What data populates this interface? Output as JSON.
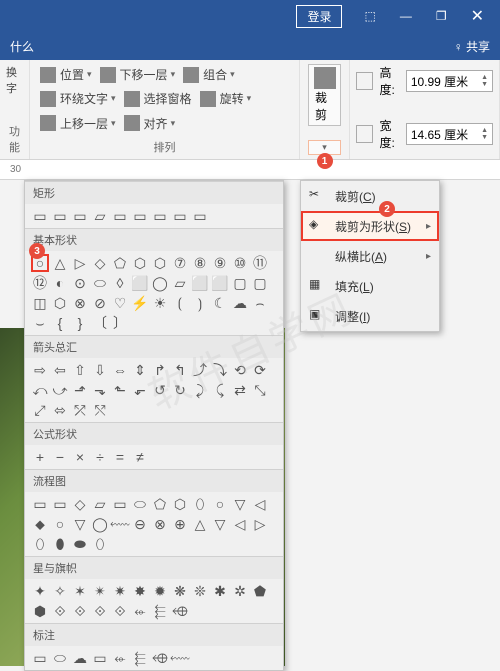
{
  "title_bar": {
    "login": "登录",
    "restore_full": "⬚",
    "minimize": "—",
    "restore": "❐",
    "close": "✕"
  },
  "tab_row": {
    "tell_me": "什么",
    "share": "共享"
  },
  "ribbon": {
    "position": "位置",
    "wrap": "环绕文字",
    "send_forward": "上移一层",
    "send_backward": "下移一层",
    "selection_pane": "选择窗格",
    "align": "对齐",
    "group": "组合",
    "rotate": "旋转",
    "arrange_label": "排列",
    "crop": "裁剪",
    "height_label": "高度:",
    "width_label": "宽度:",
    "height_val": "10.99 厘米",
    "width_val": "14.65 厘米",
    "alt_group": "换字",
    "alt_label": "功能"
  },
  "ruler_val": "30",
  "crop_menu": {
    "crop": "裁剪(C)",
    "crop_to_shape": "裁剪为形状(S)",
    "aspect_ratio": "纵横比(A)",
    "fill": "填充(L)",
    "fit": "调整(I)"
  },
  "shape_categories": {
    "rectangles": "矩形",
    "basic": "基本形状",
    "arrows": "箭头总汇",
    "equation": "公式形状",
    "flowchart": "流程图",
    "stars": "星与旗帜",
    "callouts": "标注"
  },
  "shapes": {
    "rectangles": [
      "▭",
      "▭",
      "▭",
      "▱",
      "▭",
      "▭",
      "▭",
      "▭",
      "▭"
    ],
    "basic": [
      "○",
      "△",
      "▷",
      "◇",
      "⬠",
      "⬡",
      "⬡",
      "⑦",
      "⑧",
      "⑨",
      "⑩",
      "⑪",
      "⑫",
      "◐",
      "⊙",
      "⬭",
      "◊",
      "⬜",
      "◯",
      "▱",
      "⬜",
      "⬜",
      "▢",
      "▢",
      "◫",
      "⬡",
      "⊗",
      "⊘",
      "♡",
      "⚡",
      "☀",
      "⟮",
      "⟯",
      "☾",
      "☁",
      "⌢",
      "⌣",
      "{",
      "}",
      "〔",
      "〕"
    ],
    "arrows": [
      "⇨",
      "⇦",
      "⇧",
      "⇩",
      "⇔",
      "⇕",
      "↱",
      "↰",
      "⤴",
      "⤵",
      "⟲",
      "⟳",
      "⤺",
      "⤻",
      "⬏",
      "⬎",
      "⬑",
      "⬐",
      "↺",
      "↻",
      "⤸",
      "⤹",
      "⇄",
      "⤡",
      "⤢",
      "⬄",
      "⤱",
      "⤲"
    ],
    "equation": [
      "+",
      "−",
      "×",
      "÷",
      "=",
      "≠"
    ],
    "flowchart": [
      "▭",
      "▭",
      "◇",
      "▱",
      "▭",
      "⬭",
      "⬠",
      "⬡",
      "⬯",
      "○",
      "▽",
      "◁",
      "⬥",
      "○",
      "▽",
      "◯",
      "⬳",
      "⊖",
      "⊗",
      "⊕",
      "△",
      "▽",
      "◁",
      "▷",
      "⬯",
      "⬮",
      "⬬",
      "⬯"
    ],
    "stars": [
      "✦",
      "✧",
      "✶",
      "✴",
      "✷",
      "✸",
      "✹",
      "❋",
      "❊",
      "✱",
      "✲",
      "⬟",
      "⬢",
      "⟐",
      "⟐",
      "⟐",
      "⟐",
      "⬰",
      "⬱",
      "⬲"
    ],
    "callouts": [
      "▭",
      "⬭",
      "☁",
      "▭",
      "⬰",
      "⬱",
      "⬲",
      "⬳"
    ]
  },
  "badges": {
    "b1": "1",
    "b2": "2",
    "b3": "3"
  },
  "watermark": "软件自学网"
}
